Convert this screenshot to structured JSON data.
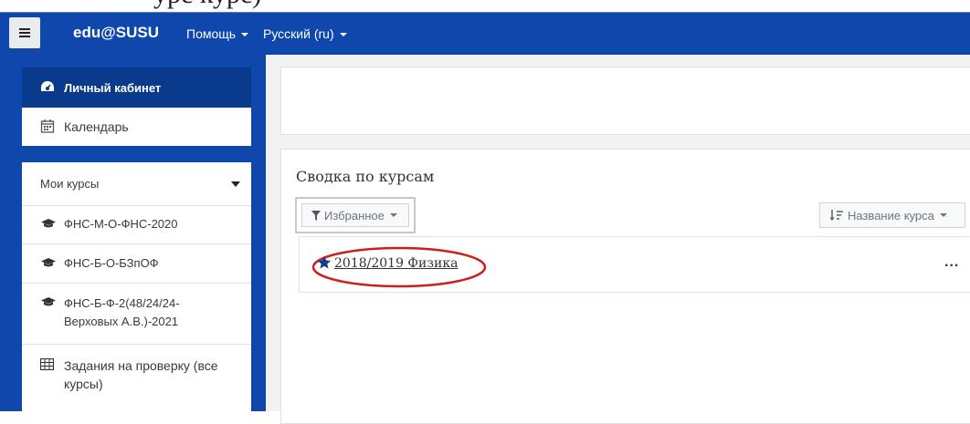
{
  "top_fragment": "урс           курс)",
  "navbar": {
    "brand": "edu@SUSU",
    "help_menu": "Помощь",
    "language_menu": "Русский (ru)"
  },
  "drawer": {
    "dashboard": "Личный кабинет",
    "calendar": "Календарь",
    "my_courses": {
      "heading": "Мои курсы",
      "items": [
        {
          "label": "ФНС-М-О-ФНС-2020"
        },
        {
          "label": "ФНС-Б-О-БЗпОФ"
        },
        {
          "label": "ФНС-Б-Ф-2(48/24/24-Верховых А.В.)-2021"
        }
      ],
      "assignments": "Задания на проверку (все курсы)"
    }
  },
  "main": {
    "overview_title": "Сводка по курсам",
    "filter_button": "Избранное",
    "sort_button": "Название курса",
    "courses": [
      {
        "name": "2018/2019 Физика",
        "starred": true
      }
    ],
    "course_menu": "..."
  },
  "colors": {
    "navbar": "#0f47ad",
    "drawer_active": "#0a3a8c",
    "highlight_ellipse": "#cc1f1f"
  }
}
